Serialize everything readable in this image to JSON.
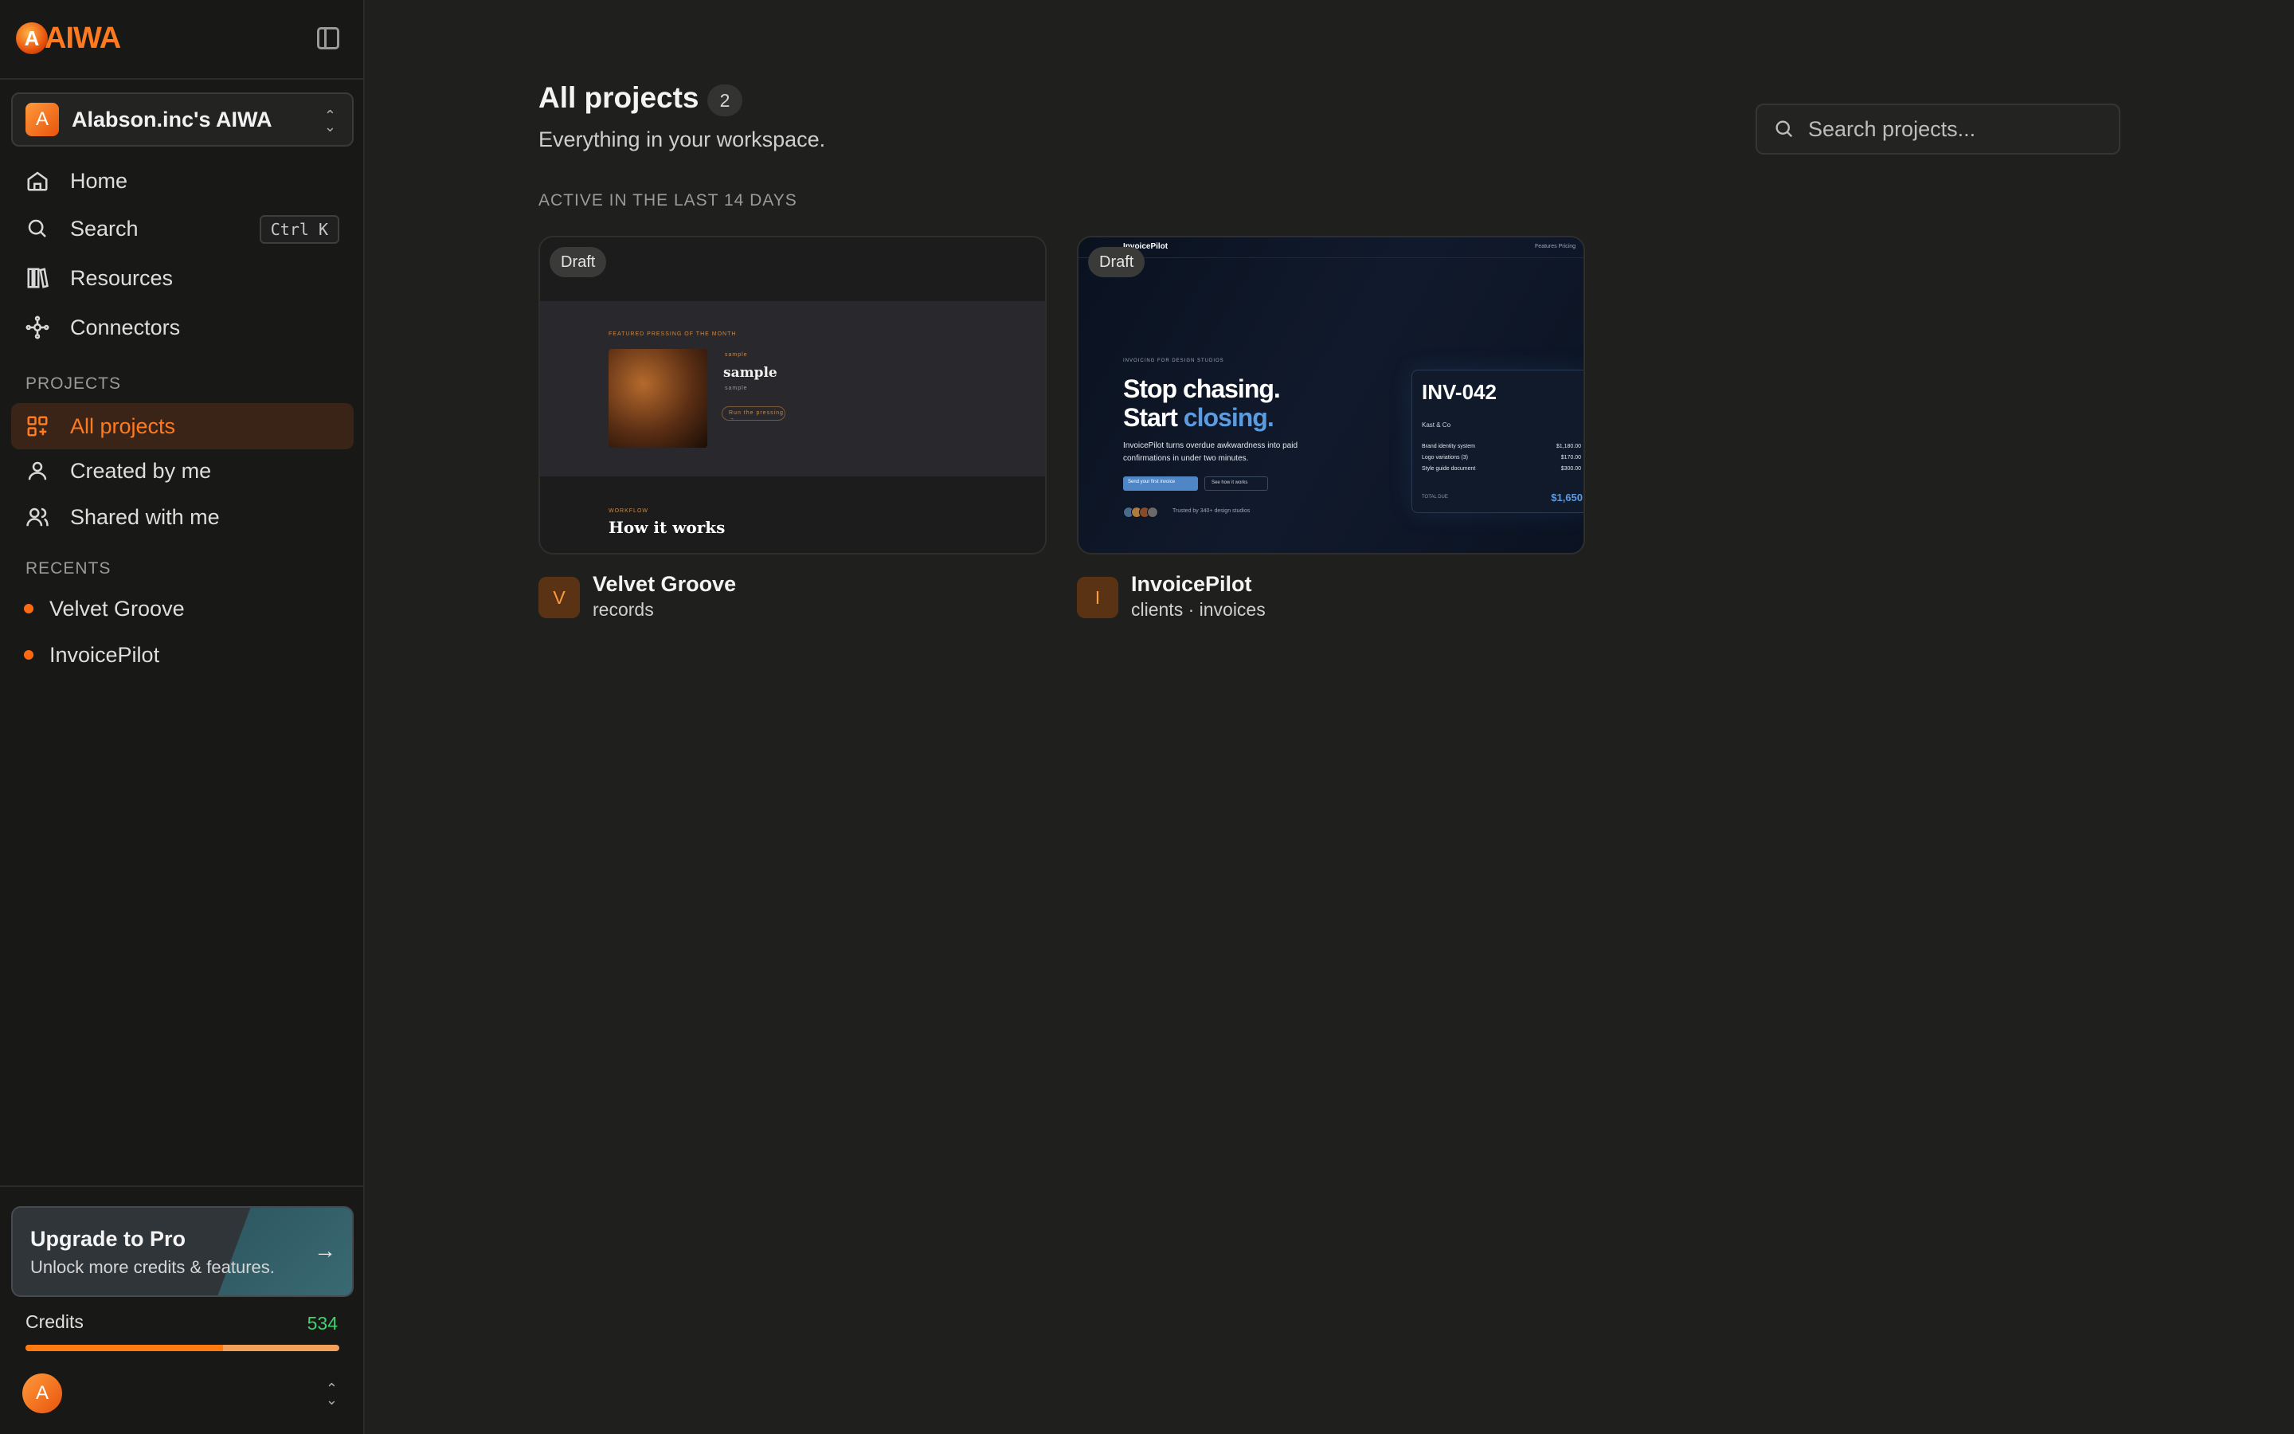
{
  "sidebar": {
    "logo_text": "AIWA",
    "workspace": {
      "avatar_letter": "A",
      "name": "Alabson.inc's AIWA"
    },
    "nav": [
      {
        "label": "Home",
        "icon": "home-icon"
      },
      {
        "label": "Search",
        "icon": "search-icon",
        "shortcut": "Ctrl K"
      },
      {
        "label": "Resources",
        "icon": "books-icon"
      },
      {
        "label": "Connectors",
        "icon": "connectors-icon"
      }
    ],
    "projects_label": "PROJECTS",
    "projects_nav": [
      {
        "label": "All projects",
        "icon": "grid-plus-icon",
        "active": true
      },
      {
        "label": "Created by me",
        "icon": "user-icon"
      },
      {
        "label": "Shared with me",
        "icon": "users-icon"
      }
    ],
    "recents_label": "RECENTS",
    "recents": [
      {
        "label": "Velvet Groove"
      },
      {
        "label": "InvoicePilot"
      }
    ],
    "upgrade": {
      "title": "Upgrade to Pro",
      "subtitle": "Unlock more credits & features."
    },
    "credits": {
      "label": "Credits",
      "value": "534",
      "used_fraction": 0.63
    },
    "user": {
      "avatar_letter": "A"
    }
  },
  "main": {
    "title": "All projects",
    "count": "2",
    "subtitle": "Everything in your workspace.",
    "search_placeholder": "Search projects...",
    "group_label": "ACTIVE IN THE LAST 14 DAYS",
    "projects": [
      {
        "badge": "Draft",
        "avatar_letter": "V",
        "name": "Velvet Groove",
        "subtitle": "records",
        "preview": {
          "kicker": "FEATURED PRESSING OF THE MONTH",
          "tag": "sample",
          "title": "sample",
          "meta": "sample",
          "button": "Run the pressing →",
          "section_kicker": "WORKFLOW",
          "heading": "How it works"
        }
      },
      {
        "badge": "Draft",
        "avatar_letter": "I",
        "name": "InvoicePilot",
        "subtitle": "clients · invoices",
        "preview": {
          "brand": "InvoicePilot",
          "links": "Features   Pricing",
          "kicker": "INVOICING FOR DESIGN STUDIOS",
          "headline_1": "Stop chasing.",
          "headline_2a": "Start ",
          "headline_2b": "closing.",
          "description": "InvoicePilot turns overdue awkwardness into paid confirmations in under two minutes.",
          "btn_primary": "Send your first invoice",
          "btn_secondary": "See how it works",
          "trust": "Trusted by 340+ design studios",
          "invoice_no": "INV-042",
          "bill_to": "Kast & Co",
          "rows": [
            {
              "item": "Brand identity system",
              "amount": "$1,180.00"
            },
            {
              "item": "Logo variations (3)",
              "amount": "$170.00"
            },
            {
              "item": "Style guide document",
              "amount": "$300.00"
            }
          ],
          "total_label": "TOTAL DUE",
          "total": "$1,650"
        }
      }
    ]
  },
  "colors": {
    "accent": "#ff7a1f",
    "credits_green": "#3fd26f",
    "active_bg": "#3a2417"
  }
}
